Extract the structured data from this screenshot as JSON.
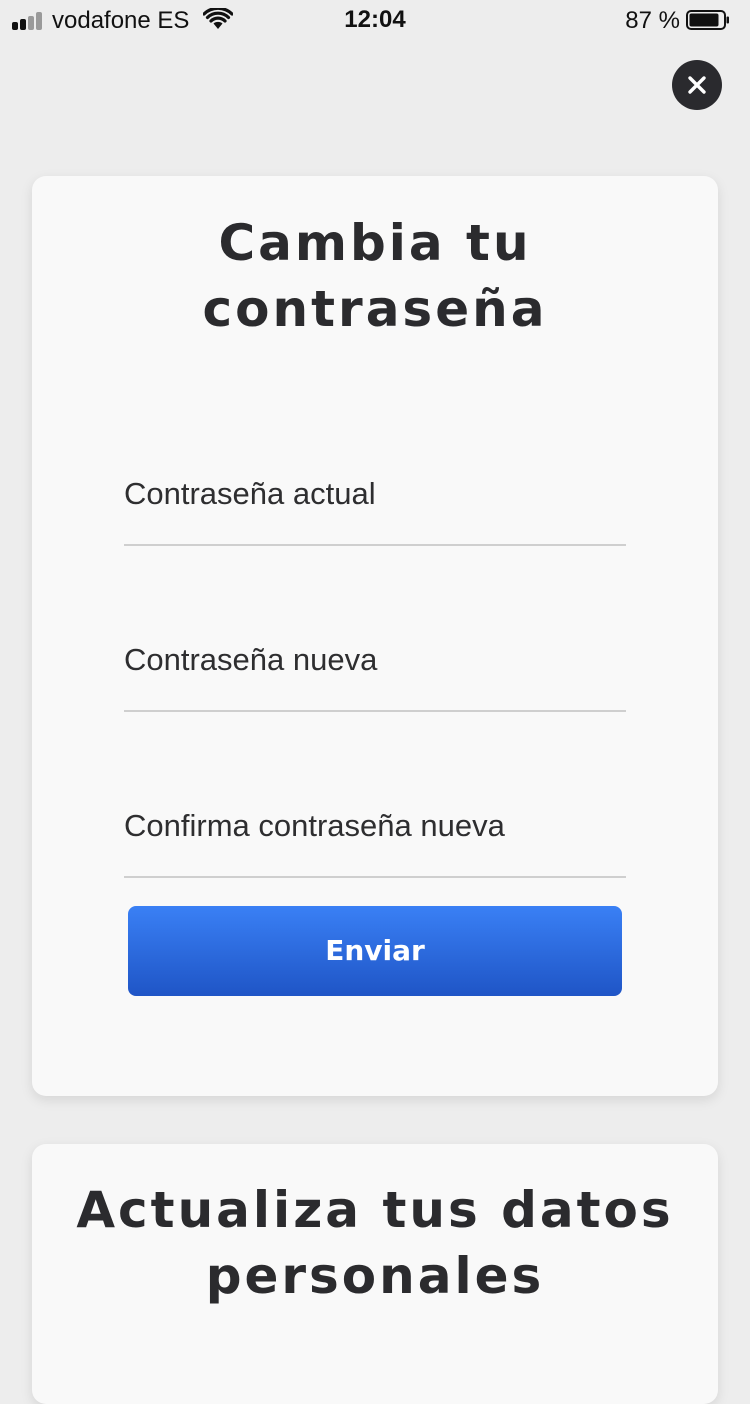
{
  "status_bar": {
    "carrier": "vodafone ES",
    "time": "12:04",
    "battery_percent": "87 %",
    "signal_bars": 4,
    "signal_bars_active": 2
  },
  "close_icon": "close-icon",
  "password_card": {
    "title_line1": "Cambia tu",
    "title_line2": "contraseña",
    "fields": [
      {
        "placeholder": "Contraseña actual",
        "value": ""
      },
      {
        "placeholder": "Contraseña nueva",
        "value": ""
      },
      {
        "placeholder": "Confirma contraseña nueva",
        "value": ""
      }
    ],
    "submit_label": "Enviar"
  },
  "personal_card": {
    "title_line1": "Actualiza tus datos",
    "title_line2": "personales"
  },
  "colors": {
    "background": "#ededed",
    "card": "#f9f9f9",
    "text": "#2b2b2e",
    "button_top": "#3a80f5",
    "button_bottom": "#1f55c6",
    "close_button": "#2a2a2e"
  }
}
